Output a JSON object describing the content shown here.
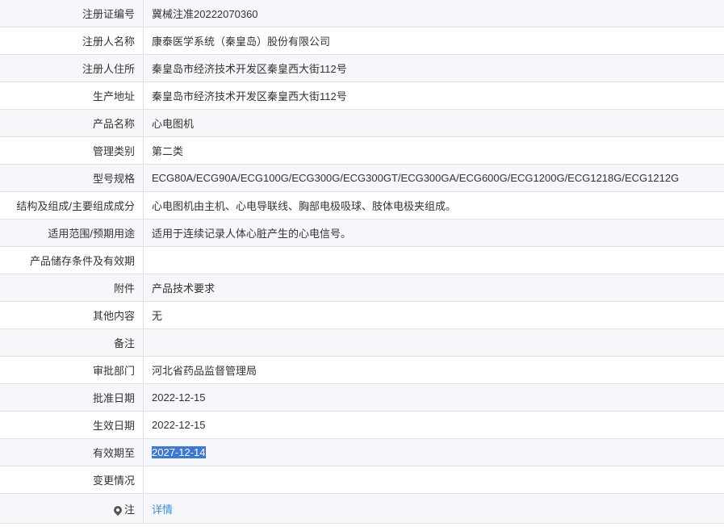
{
  "rows": [
    {
      "label": "注册证编号",
      "value": "冀械注准20222070360"
    },
    {
      "label": "注册人名称",
      "value": "康泰医学系统（秦皇岛）股份有限公司"
    },
    {
      "label": "注册人住所",
      "value": "秦皇岛市经济技术开发区秦皇西大街112号"
    },
    {
      "label": "生产地址",
      "value": "秦皇岛市经济技术开发区秦皇西大街112号"
    },
    {
      "label": "产品名称",
      "value": "心电图机"
    },
    {
      "label": "管理类别",
      "value": "第二类"
    },
    {
      "label": "型号规格",
      "value": "ECG80A/ECG90A/ECG100G/ECG300G/ECG300GT/ECG300GA/ECG600G/ECG1200G/ECG1218G/ECG1212G"
    },
    {
      "label": "结构及组成/主要组成成分",
      "value": "心电图机由主机、心电导联线、胸部电极吸球、肢体电极夹组成。"
    },
    {
      "label": "适用范围/预期用途",
      "value": "适用于连续记录人体心脏产生的心电信号。"
    },
    {
      "label": "产品储存条件及有效期",
      "value": ""
    },
    {
      "label": "附件",
      "value": "产品技术要求"
    },
    {
      "label": "其他内容",
      "value": "无"
    },
    {
      "label": "备注",
      "value": ""
    },
    {
      "label": "审批部门",
      "value": "河北省药品监督管理局"
    },
    {
      "label": "批准日期",
      "value": "2022-12-15"
    },
    {
      "label": "生效日期",
      "value": "2022-12-15"
    },
    {
      "label": "有效期至",
      "value": "2027-12-14"
    },
    {
      "label": "变更情况",
      "value": ""
    },
    {
      "label": "注",
      "value": "详情"
    }
  ],
  "colors": {
    "row_alt": "#f5f7fa",
    "border": "#dcdfe6",
    "selection": "#3b78d8",
    "link": "#3a8ee6"
  },
  "icons": {
    "note": "location-pin-icon"
  }
}
